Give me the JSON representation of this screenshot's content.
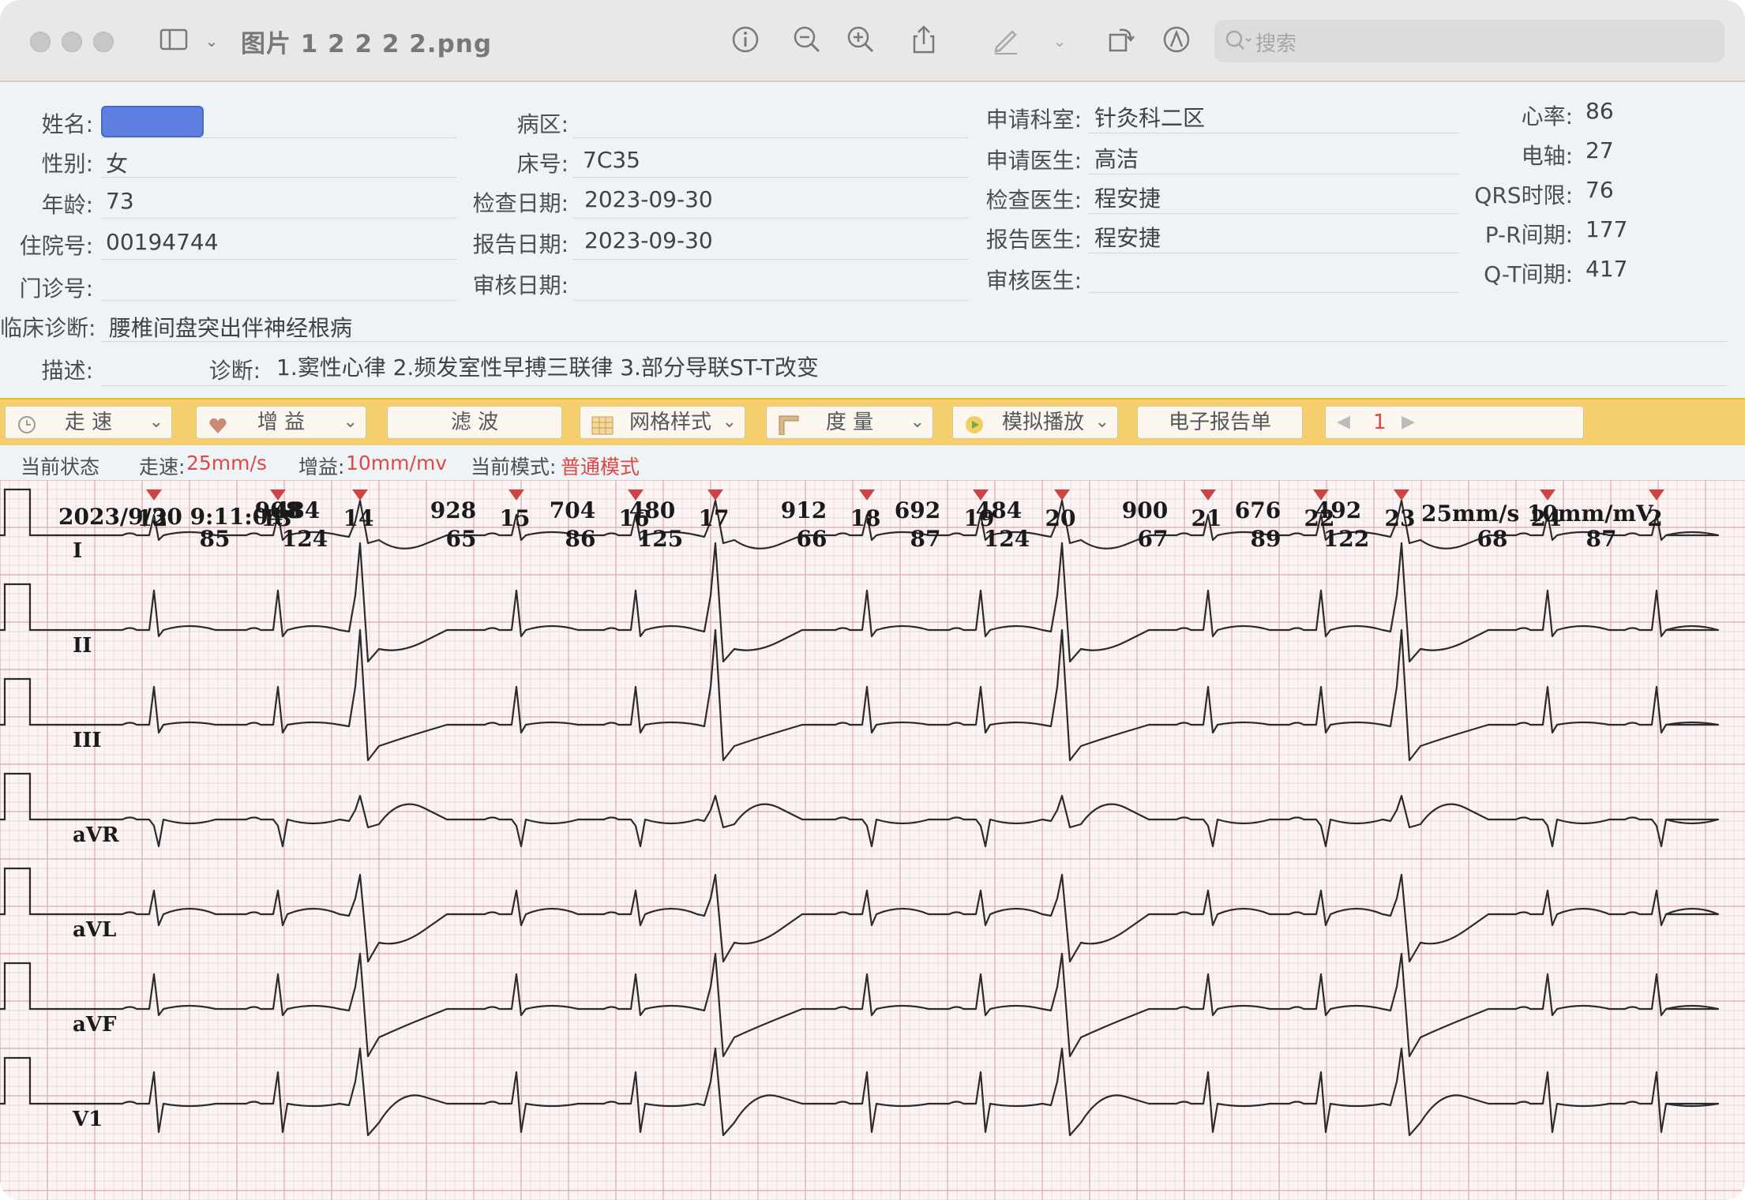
{
  "window": {
    "title": "图片 1 2 2 2 2.png",
    "search_placeholder": "搜索",
    "toolbar_icons": [
      "sidebar-icon",
      "chevron-down-icon",
      "info-icon",
      "zoom-out-icon",
      "zoom-in-icon",
      "share-icon",
      "markup-pen-icon",
      "chevron-down-icon",
      "rotate-icon",
      "annotate-icon"
    ]
  },
  "patient": {
    "name_label": "姓名:",
    "sex_label": "性别:",
    "sex": "女",
    "age_label": "年龄:",
    "age": "73",
    "inpatient_label": "住院号:",
    "inpatient_no": "00194744",
    "outpatient_label": "门诊号:",
    "outpatient_no": "",
    "ward_label": "病区:",
    "ward": "",
    "bed_label": "床号:",
    "bed": "7C35",
    "exam_date_label": "检查日期:",
    "exam_date": "2023-09-30",
    "report_date_label": "报告日期:",
    "report_date": "2023-09-30",
    "review_date_label": "审核日期:",
    "review_date": "",
    "dept_label": "申请科室:",
    "dept": "针灸科二区",
    "req_doctor_label": "申请医生:",
    "req_doctor": "高洁",
    "exam_doctor_label": "检查医生:",
    "exam_doctor": "程安捷",
    "report_doctor_label": "报告医生:",
    "report_doctor": "程安捷",
    "review_doctor_label": "审核医生:",
    "review_doctor": "",
    "clinical_label": "临床诊断:",
    "clinical": "腰椎间盘突出伴神经根病",
    "desc_label": "描述:",
    "diag_label": "诊断:",
    "diagnosis": "1.窦性心律 2.频发室性早搏三联律 3.部分导联ST-T改变"
  },
  "measurements": {
    "hr_label": "心率:",
    "hr": "86",
    "axis_label": "电轴:",
    "axis": "27",
    "qrs_label": "QRS时限:",
    "qrs": "76",
    "pr_label": "P-R间期:",
    "pr": "177",
    "qt_label": "Q-T间期:",
    "qt": "417"
  },
  "toolbar": {
    "speed": "走 速",
    "gain": "增 益",
    "filter": "滤 波",
    "grid": "网格样式",
    "measure": "度 量",
    "playback": "模拟播放",
    "report": "电子报告单",
    "page": "1"
  },
  "status": {
    "state_label": "当前状态",
    "speed_label": "走速:",
    "speed_value": "25mm/s",
    "gain_label": "增益:",
    "gain_value": "10mm/mv",
    "mode_label": "当前模式:",
    "mode_value": "普通模式"
  },
  "ecg": {
    "header_left": "2023/9/30 9:11:04",
    "header_right": "25mm/s 10mm/mV",
    "leads": [
      "I",
      "II",
      "III",
      "aVR",
      "aVL",
      "aVF",
      "V1"
    ],
    "beats": [
      {
        "num": "12",
        "rr": "",
        "val": ""
      },
      {
        "num": "13",
        "rr": "908",
        "val": "85"
      },
      {
        "num": "14",
        "rr": "484",
        "val": "124"
      },
      {
        "num": "15",
        "rr": "928",
        "val": "65"
      },
      {
        "num": "16",
        "rr": "704",
        "val": "86"
      },
      {
        "num": "17",
        "rr": "480",
        "val": "125"
      },
      {
        "num": "18",
        "rr": "912",
        "val": "66"
      },
      {
        "num": "19",
        "rr": "692",
        "val": "87"
      },
      {
        "num": "20",
        "rr": "484",
        "val": "124"
      },
      {
        "num": "21",
        "rr": "900",
        "val": "67"
      },
      {
        "num": "22",
        "rr": "676",
        "val": "89"
      },
      {
        "num": "23",
        "rr": "492",
        "val": "122"
      },
      {
        "num": "24",
        "rr": "",
        "val": "68"
      },
      {
        "num": "2",
        "rr": "",
        "val": "87"
      }
    ],
    "colors": {
      "grid_minor": "#f1d9d9",
      "grid_major": "#e2b3b3",
      "trace": "#2b2b2b",
      "marker": "#cc4444",
      "paper": "#fbf4f4"
    }
  }
}
